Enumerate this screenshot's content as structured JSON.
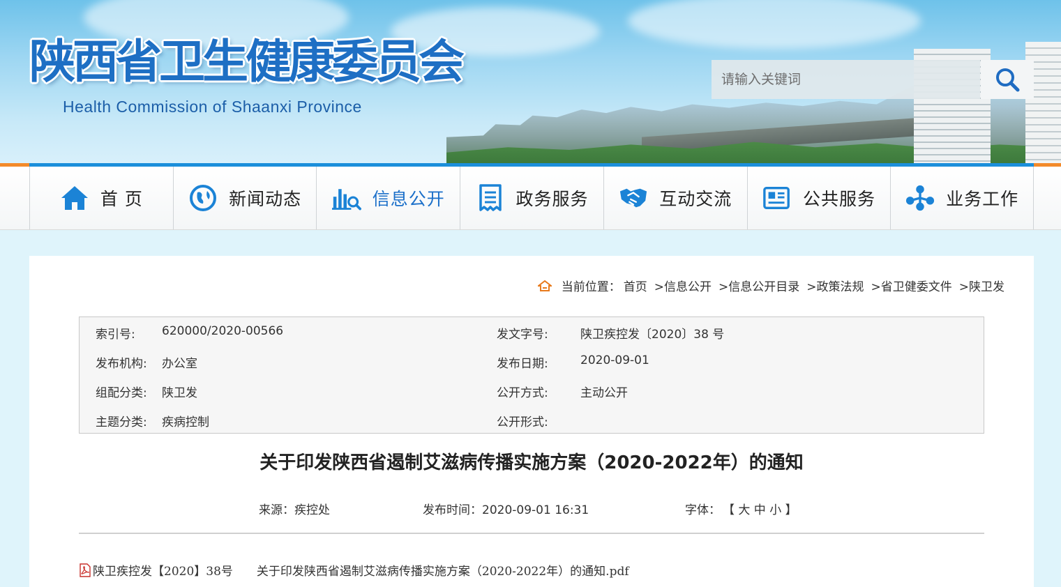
{
  "header": {
    "title": "陕西省卫生健康委员会",
    "subtitle": "Health Commission of Shaanxi Province",
    "search": {
      "placeholder": "请输入关键词",
      "icon": "search-icon"
    }
  },
  "nav": [
    {
      "label": "首 页",
      "icon": "home-icon"
    },
    {
      "label": "新闻动态",
      "icon": "globe-icon"
    },
    {
      "label": "信息公开",
      "icon": "chart-search-icon",
      "active": true
    },
    {
      "label": "政务服务",
      "icon": "document-icon"
    },
    {
      "label": "互动交流",
      "icon": "handshake-icon"
    },
    {
      "label": "公共服务",
      "icon": "newspaper-icon"
    },
    {
      "label": "业务工作",
      "icon": "network-icon"
    }
  ],
  "breadcrumb": {
    "prefix": "当前位置：",
    "icon": "home-outline-icon",
    "items": [
      "首页",
      ">信息公开",
      ">信息公开目录",
      ">政策法规",
      ">省卫健委文件",
      ">陕卫发"
    ]
  },
  "meta": {
    "index_label": "索引号:",
    "index_value": "620000/2020-00566",
    "docno_label": "发文字号:",
    "docno_value": "陕卫疾控发〔2020〕38 号",
    "org_label": "发布机构:",
    "org_value": "办公室",
    "date_label": "发布日期:",
    "date_value": "2020-09-01",
    "group_label": "组配分类:",
    "group_value": "陕卫发",
    "open_label": "公开方式:",
    "open_value": "主动公开",
    "topic_label": "主题分类:",
    "topic_value": "疾病控制",
    "form_label": "公开形式:",
    "form_value": ""
  },
  "article": {
    "title": "关于印发陕西省遏制艾滋病传播实施方案（2020-2022年）的通知",
    "source": "来源：疾控处",
    "publish_time": "发布时间：2020-09-01 16:31",
    "font_label": "字体：",
    "font_sizes": "【 大 中 小 】",
    "attachment": "陕卫疾控发【2020】38号　　关于印发陕西省遏制艾滋病传播实施方案（2020-2022年）的通知.pdf"
  },
  "colors": {
    "brand_blue": "#1e6fc4",
    "accent_orange": "#f38a2a",
    "nav_blue": "#1b8fdb"
  }
}
